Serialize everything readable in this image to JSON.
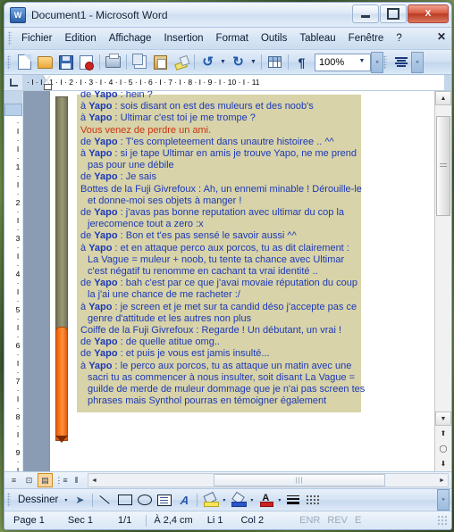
{
  "window": {
    "title": "Document1 - Microsoft Word",
    "app_icon": "word-icon",
    "icon_letter": "W",
    "minimize_label": "Réduire",
    "maximize_label": "Agrandir",
    "close_label": "X"
  },
  "menubar": {
    "items": [
      {
        "label": "Fichier",
        "accel": "F"
      },
      {
        "label": "Edition",
        "accel": "E"
      },
      {
        "label": "Affichage",
        "accel": "A"
      },
      {
        "label": "Insertion",
        "accel": "I"
      },
      {
        "label": "Format",
        "accel": "t"
      },
      {
        "label": "Outils",
        "accel": "O"
      },
      {
        "label": "Tableau",
        "accel": "b"
      },
      {
        "label": "Fenêtre",
        "accel": "n"
      },
      {
        "label": "?",
        "accel": ""
      }
    ],
    "close_document_label": "✕"
  },
  "toolbar": {
    "buttons": [
      {
        "name": "new-document",
        "icon": "new-document-icon"
      },
      {
        "name": "open",
        "icon": "open-folder-icon"
      },
      {
        "name": "save",
        "icon": "save-disk-icon"
      },
      {
        "name": "permission",
        "icon": "mail-permission-icon"
      },
      {
        "name": "print",
        "icon": "printer-icon"
      },
      {
        "name": "copy",
        "icon": "copy-icon"
      },
      {
        "name": "paste",
        "icon": "paste-icon"
      },
      {
        "name": "format-painter",
        "icon": "format-painter-icon"
      },
      {
        "name": "undo",
        "icon": "undo-icon"
      },
      {
        "name": "redo",
        "icon": "redo-icon"
      },
      {
        "name": "insert-table",
        "icon": "table-icon"
      },
      {
        "name": "show-formatting",
        "icon": "pilcrow-icon"
      }
    ],
    "undo_glyph": "↺",
    "redo_glyph": "↻",
    "pilcrow_glyph": "¶",
    "zoom_value": "100%",
    "zoom_placeholder": "100%",
    "overflow_glyph": "»",
    "align_icon": "align-justify-icon"
  },
  "ruler": {
    "horizontal_ticks": "·  I  ·  I  ·  1  ·  I  ·  2  ·  I  ·  3  ·  I  ·  4  ·  I  ·  5  ·  I  ·  6  ·  I  ·  7  ·  I  ·  8  ·  I  ·  9  ·  I  · 10 ·  I  · 11",
    "vertical_ticks": "·I·I·1·I·2·I·3·I·4·I·5·I·6·I·7·I·8·I·9·I·",
    "tab_selector": "left-tab-stop"
  },
  "document": {
    "lines": [
      {
        "prefix": "de ",
        "name": "Yapo",
        "text": " : hein ?",
        "style": "blue",
        "indent": false,
        "clipped_top": true
      },
      {
        "prefix": "à ",
        "name": "Yapo",
        "text": " : sois disant on est des muleurs et des noob's",
        "style": "blue",
        "indent": false
      },
      {
        "prefix": "à ",
        "name": "Yapo",
        "text": " : Ultimar c'est toi je me trompe ?",
        "style": "blue",
        "indent": false
      },
      {
        "prefix": "",
        "name": "",
        "text": "Vous venez de perdre un ami.",
        "style": "red",
        "indent": false
      },
      {
        "prefix": "de ",
        "name": "Yapo",
        "text": " : T'es completeement dans unautre histoiree .. ^^",
        "style": "blue",
        "indent": false
      },
      {
        "prefix": "à ",
        "name": "Yapo",
        "text": " : si je tape Ultimar en amis je trouve Yapo, ne me prend",
        "style": "blue",
        "indent": false
      },
      {
        "prefix": "",
        "name": "",
        "text": "pas pour une débile",
        "style": "blue",
        "indent": true
      },
      {
        "prefix": "de ",
        "name": "Yapo",
        "text": " : Je sais",
        "style": "blue",
        "indent": false
      },
      {
        "prefix": "",
        "name": "",
        "text": "Bottes de la Fuji Givrefoux : Ah, un ennemi minable ! Dérouille-le",
        "style": "blue",
        "indent": false
      },
      {
        "prefix": "",
        "name": "",
        "text": "et donne-moi ses objets à manger !",
        "style": "blue",
        "indent": true
      },
      {
        "prefix": "de ",
        "name": "Yapo",
        "text": " : j'avas pas bonne reputation avec ultimar du cop la",
        "style": "blue",
        "indent": false
      },
      {
        "prefix": "",
        "name": "",
        "text": "jerecomence tout a zero :x",
        "style": "blue",
        "indent": true
      },
      {
        "prefix": "de ",
        "name": "Yapo",
        "text": " : Bon et t'es pas sensé le savoir aussi ^^",
        "style": "blue",
        "indent": false
      },
      {
        "prefix": "à ",
        "name": "Yapo",
        "text": " : et en attaque perco aux porcos, tu as dit clairement :",
        "style": "blue",
        "indent": false
      },
      {
        "prefix": "",
        "name": "",
        "text": "La Vague = muleur + noob, tu tente ta chance avec Ultimar",
        "style": "blue",
        "indent": true
      },
      {
        "prefix": "",
        "name": "",
        "text": "c'est négatif tu renomme en cachant ta vrai identité ..",
        "style": "blue",
        "indent": true
      },
      {
        "prefix": "de ",
        "name": "Yapo",
        "text": " : bah c'est par ce que j'avai movaie réputation du coup",
        "style": "blue",
        "indent": false
      },
      {
        "prefix": "",
        "name": "",
        "text": "la j'ai une chance de me racheter :/",
        "style": "blue",
        "indent": true
      },
      {
        "prefix": "à ",
        "name": "Yapo",
        "text": " : je screen et je met sur ta candid déso j'accepte pas ce",
        "style": "blue",
        "indent": false
      },
      {
        "prefix": "",
        "name": "",
        "text": "genre d'attitude et les autres non plus",
        "style": "blue",
        "indent": true
      },
      {
        "prefix": "",
        "name": "",
        "text": "Coiffe de la Fuji Givrefoux : Regarde ! Un débutant, un vrai !",
        "style": "blue",
        "indent": false
      },
      {
        "prefix": "de ",
        "name": "Yapo",
        "text": " : de quelle atitue omg..",
        "style": "blue",
        "indent": false
      },
      {
        "prefix": "de ",
        "name": "Yapo",
        "text": " : et puis je vous est jamis insulté...",
        "style": "blue",
        "indent": false
      },
      {
        "prefix": "à ",
        "name": "Yapo",
        "text": " : le perco aux porcos, tu as attaque un matin avec une",
        "style": "blue",
        "indent": false
      },
      {
        "prefix": "",
        "name": "",
        "text": "sacri tu as commencer à nous insulter, soit disant La Vague =",
        "style": "blue",
        "indent": true
      },
      {
        "prefix": "",
        "name": "",
        "text": "guilde de merde de muleur dommage que je n'ai pas screen tes",
        "style": "blue",
        "indent": true
      },
      {
        "prefix": "",
        "name": "",
        "text": "phrases mais Synthol pourras en témoigner également",
        "style": "blue",
        "indent": true
      }
    ],
    "selection_color": "#d8d3a8",
    "text_color": "#1c39b8",
    "alert_color": "#cc3311",
    "shape": {
      "name": "orange-vertical-bar",
      "body_color": "#8a8968",
      "fill_color": "#ff7a1e"
    }
  },
  "viewbar": {
    "buttons": [
      {
        "name": "normal-view",
        "glyph": "≡",
        "active": false
      },
      {
        "name": "web-layout-view",
        "glyph": "⊡",
        "active": false
      },
      {
        "name": "print-layout-view",
        "glyph": "▤",
        "active": true
      },
      {
        "name": "outline-view",
        "glyph": "⋮≡",
        "active": false
      },
      {
        "name": "reading-view",
        "glyph": "⫴",
        "active": false
      }
    ],
    "scroll_left_glyph": "◄",
    "scroll_right_glyph": "►",
    "thumb_grip": "|||"
  },
  "scrollbar": {
    "up_glyph": "▲",
    "down_glyph": "▼",
    "prev_page_glyph": "⬆",
    "select_object_glyph": "◯",
    "next_page_glyph": "⬇",
    "thumb_grip": "≡"
  },
  "drawbar": {
    "menu_label": "Dessiner",
    "menu_accel": "D",
    "dropdown_glyph": "▾",
    "buttons": [
      {
        "name": "select-objects",
        "icon": "cursor-arrow-icon"
      },
      {
        "name": "draw-line",
        "icon": "line-icon"
      },
      {
        "name": "draw-rectangle",
        "icon": "rectangle-icon"
      },
      {
        "name": "draw-oval",
        "icon": "oval-icon"
      },
      {
        "name": "insert-text-box",
        "icon": "text-box-icon"
      },
      {
        "name": "insert-wordart",
        "icon": "wordart-icon"
      },
      {
        "name": "fill-color",
        "icon": "fill-color-icon"
      },
      {
        "name": "line-color",
        "icon": "line-color-icon"
      },
      {
        "name": "font-color",
        "icon": "font-color-icon"
      },
      {
        "name": "line-style",
        "icon": "line-style-icon"
      },
      {
        "name": "dash-style",
        "icon": "dash-style-icon"
      }
    ],
    "wordart_letter": "A",
    "fontcolor_letter": "A",
    "overflow_glyph": "»"
  },
  "statusbar": {
    "page": "Page 1",
    "section": "Sec 1",
    "pages": "1/1",
    "at": "À 2,4 cm",
    "line": "Li 1",
    "column": "Col 2",
    "rec": "ENR",
    "trk": "REV",
    "ext": "E"
  }
}
